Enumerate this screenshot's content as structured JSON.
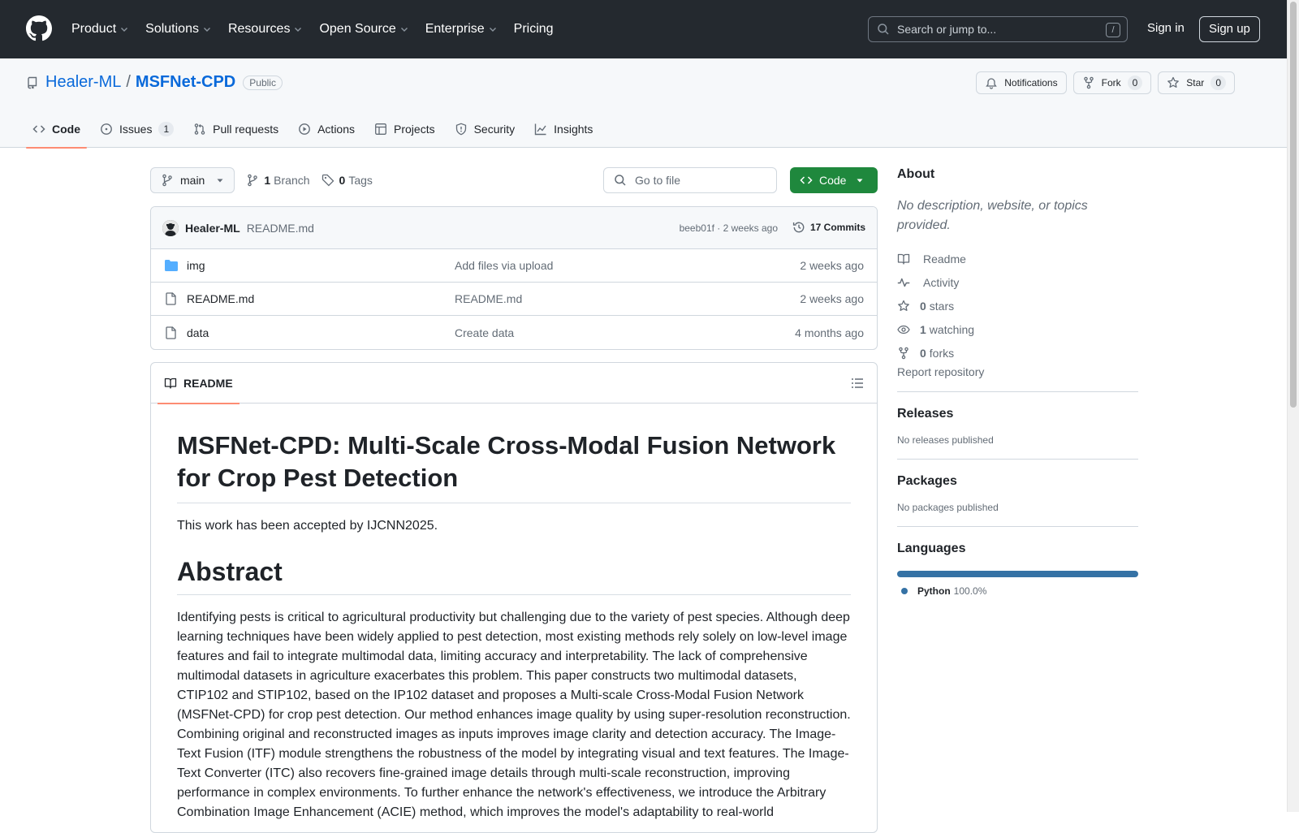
{
  "header": {
    "nav": [
      {
        "label": "Product",
        "dropdown": true
      },
      {
        "label": "Solutions",
        "dropdown": true
      },
      {
        "label": "Resources",
        "dropdown": true
      },
      {
        "label": "Open Source",
        "dropdown": true
      },
      {
        "label": "Enterprise",
        "dropdown": true
      },
      {
        "label": "Pricing",
        "dropdown": false
      }
    ],
    "search_placeholder": "Search or jump to...",
    "search_key": "/",
    "sign_in": "Sign in",
    "sign_up": "Sign up"
  },
  "repo": {
    "owner": "Healer-ML",
    "separator": "/",
    "name": "MSFNet-CPD",
    "visibility": "Public",
    "notifications_label": "Notifications",
    "fork_label": "Fork",
    "fork_count": "0",
    "star_label": "Star",
    "star_count": "0"
  },
  "tabs": [
    {
      "label": "Code",
      "icon": "code-icon",
      "active": true
    },
    {
      "label": "Issues",
      "icon": "issue-icon",
      "count": "1"
    },
    {
      "label": "Pull requests",
      "icon": "pull-request-icon"
    },
    {
      "label": "Actions",
      "icon": "play-icon"
    },
    {
      "label": "Projects",
      "icon": "table-icon"
    },
    {
      "label": "Security",
      "icon": "shield-icon"
    },
    {
      "label": "Insights",
      "icon": "graph-icon"
    }
  ],
  "toolbar": {
    "branch": "main",
    "branch_count": "1",
    "branch_label": "Branch",
    "tag_count": "0",
    "tag_label": "Tags",
    "goto_placeholder": "Go to file",
    "code_label": "Code"
  },
  "commit": {
    "author": "Healer-ML",
    "message": "README.md",
    "meta": "beeb01f · 2 weeks ago",
    "commits_label": "17 Commits"
  },
  "files": [
    {
      "name": "img",
      "type": "folder",
      "message": "Add files via upload",
      "age": "2 weeks ago"
    },
    {
      "name": "README.md",
      "type": "file",
      "message": "README.md",
      "age": "2 weeks ago"
    },
    {
      "name": "data",
      "type": "file",
      "message": "Create data",
      "age": "4 months ago"
    }
  ],
  "readme": {
    "tab_label": "README",
    "title": "MSFNet-CPD: Multi-Scale Cross-Modal Fusion Network for Crop Pest Detection",
    "accepted": "This work has been accepted by IJCNN2025.",
    "abstract_heading": "Abstract",
    "abstract": "Identifying pests is critical to agricultural productivity but challenging due to the variety of pest species. Although deep learning techniques have been widely applied to pest detection, most existing methods rely solely on low-level image features and fail to integrate multimodal data, limiting accuracy and interpretability. The lack of comprehensive multimodal datasets in agriculture exacerbates this problem. This paper constructs two multimodal datasets, CTIP102 and STIP102, based on the IP102 dataset and proposes a Multi-scale Cross-Modal Fusion Network (MSFNet-CPD) for crop pest detection. Our method enhances image quality by using super-resolution reconstruction. Combining original and reconstructed images as inputs improves image clarity and detection accuracy. The Image-Text Fusion (ITF) module strengthens the robustness of the model by integrating visual and text features. The Image-Text Converter (ITC) also recovers fine-grained image details through multi-scale reconstruction, improving performance in complex environments. To further enhance the network's effectiveness, we introduce the Arbitrary Combination Image Enhancement (ACIE) method, which improves the model's adaptability to real-world"
  },
  "sidebar": {
    "about_heading": "About",
    "about_desc": "No description, website, or topics provided.",
    "items": [
      {
        "icon": "book-icon",
        "count": "",
        "label": "Readme"
      },
      {
        "icon": "pulse-icon",
        "count": "",
        "label": "Activity"
      },
      {
        "icon": "star-icon",
        "count": "0",
        "label": "stars"
      },
      {
        "icon": "eye-icon",
        "count": "1",
        "label": "watching"
      },
      {
        "icon": "fork-icon",
        "count": "0",
        "label": "forks"
      }
    ],
    "report": "Report repository",
    "releases_heading": "Releases",
    "releases_text": "No releases published",
    "packages_heading": "Packages",
    "packages_text": "No packages published",
    "languages_heading": "Languages",
    "languages": [
      {
        "name": "Python",
        "percent": "100.0%",
        "color": "#3572a5"
      }
    ]
  },
  "colors": {
    "header_bg": "#24292f",
    "link": "#0969da",
    "primary_button": "#1f883d",
    "tab_underline": "#fd8c73"
  }
}
